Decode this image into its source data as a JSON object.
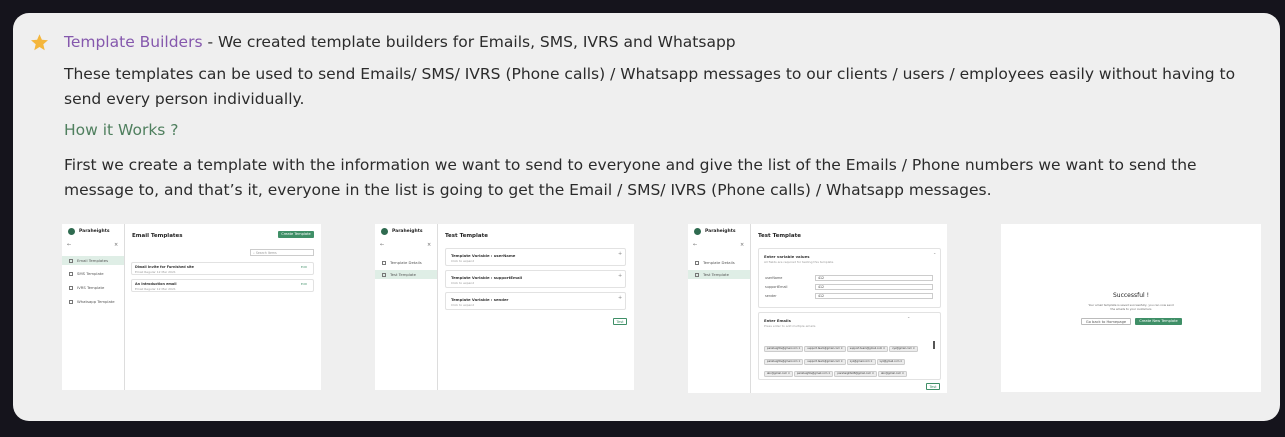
{
  "header": {
    "title_link": "Template Builders",
    "title_rest": " - We created template builders for Emails, SMS, IVRS and Whatsapp"
  },
  "description": "These templates can be used to send Emails/ SMS/ IVRS (Phone calls) / Whatsapp messages to  our clients / users / employees easily without having to send every person individually.",
  "how_heading": "How it Works ?",
  "how_text": "First we create a template with the information we want to send to everyone and give the list of the Emails / Phone numbers we want to send the message to, and that’s it, everyone in the list is going to get the Email / SMS/ IVRS (Phone calls) / Whatsapp messages.",
  "colors": {
    "accent": "#8558ad",
    "heading_green": "#4f7f5e",
    "star": "#f4b63c",
    "brand_green": "#3f8f67"
  },
  "screenshots": {
    "brand": "Paraheights",
    "s1": {
      "title": "Email Templates",
      "create_button": "Create Template",
      "search_placeholder": "Search Items",
      "nav": [
        "Email Templates",
        "SMS Template",
        "IVRS Template",
        "Whatsapp Template"
      ],
      "items": [
        {
          "title": "Diwali Invite for Furnished site",
          "meta": "Email Regular   12 Mar 2021",
          "action": "Edit"
        },
        {
          "title": "An Introduction email",
          "meta": "Email Regular   12 Mar 2021",
          "action": "Edit"
        }
      ]
    },
    "s2": {
      "title": "Test Template",
      "nav": [
        "Template Details",
        "Test Template"
      ],
      "vars": [
        {
          "label": "Template Variable : userName",
          "sub": "Click to expand"
        },
        {
          "label": "Template Variable : supportEmail",
          "sub": "Click to expand"
        },
        {
          "label": "Template Variable : sender",
          "sub": "Click to expand"
        }
      ],
      "button": "Test"
    },
    "s3": {
      "title": "Test Template",
      "nav": [
        "Template Details",
        "Test Template"
      ],
      "section1_title": "Enter variable values",
      "section1_sub": "All fields are required for testing this template",
      "fields": [
        {
          "label": "userName",
          "value": "412"
        },
        {
          "label": "supportEmail",
          "value": "412"
        },
        {
          "label": "sender",
          "value": "412"
        }
      ],
      "section2_title": "Enter Emails",
      "section2_sub": "Press enter to add multiple emails",
      "chips": [
        "paraheights@gmail.com",
        "support.team@gmail.com",
        "support.team@gmail.com",
        "xyz@gmail.com",
        "paraheights@gmail.com",
        "support.team@gmail.com",
        "xyz@gmail.com",
        "xyz@gmail.com",
        "abc@gmail.com",
        "paraheights@gmail.com",
        "paraheights08@gmail.com",
        "abc@gmail.com"
      ],
      "button": "Test"
    },
    "s4": {
      "title": "Successful !",
      "message": "Your email template is saved successfully, you can now send the emails to your customers",
      "back_button": "Go back to Homepage",
      "create_button": "Create New Template"
    }
  }
}
